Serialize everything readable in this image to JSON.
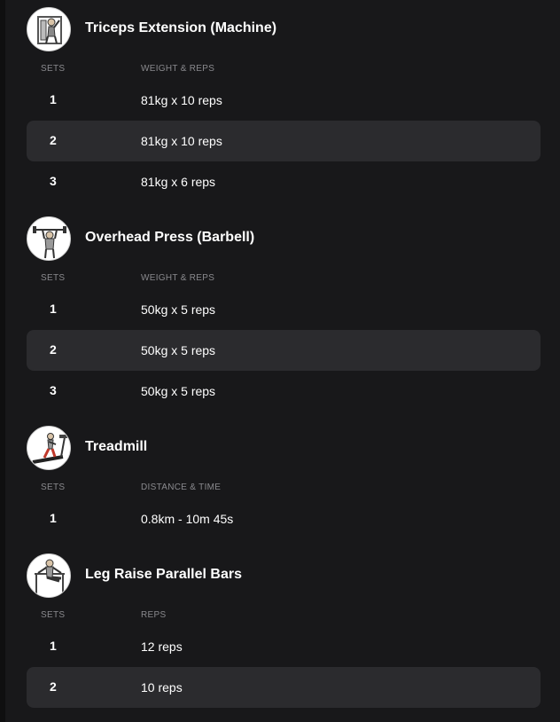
{
  "colors": {
    "background": "#18181a",
    "alt_row": "#2b2b2e",
    "label_gray": "#8a8a8e",
    "text": "#ffffff"
  },
  "exercises": [
    {
      "name": "Triceps Extension (Machine)",
      "icon": "triceps-extension-machine-icon",
      "sets_label": "SETS",
      "value_label": "WEIGHT & REPS",
      "sets": [
        {
          "num": "1",
          "value": "81kg x 10 reps"
        },
        {
          "num": "2",
          "value": "81kg x 10 reps"
        },
        {
          "num": "3",
          "value": "81kg x 6 reps"
        }
      ]
    },
    {
      "name": "Overhead Press (Barbell)",
      "icon": "overhead-press-barbell-icon",
      "sets_label": "SETS",
      "value_label": "WEIGHT & REPS",
      "sets": [
        {
          "num": "1",
          "value": "50kg x 5 reps"
        },
        {
          "num": "2",
          "value": "50kg x 5 reps"
        },
        {
          "num": "3",
          "value": "50kg x 5 reps"
        }
      ]
    },
    {
      "name": "Treadmill",
      "icon": "treadmill-icon",
      "sets_label": "SETS",
      "value_label": "DISTANCE & TIME",
      "sets": [
        {
          "num": "1",
          "value": "0.8km - 10m 45s"
        }
      ]
    },
    {
      "name": "Leg Raise Parallel Bars",
      "icon": "leg-raise-parallel-bars-icon",
      "sets_label": "SETS",
      "value_label": "REPS",
      "sets": [
        {
          "num": "1",
          "value": "12 reps"
        },
        {
          "num": "2",
          "value": "10 reps"
        }
      ]
    }
  ]
}
